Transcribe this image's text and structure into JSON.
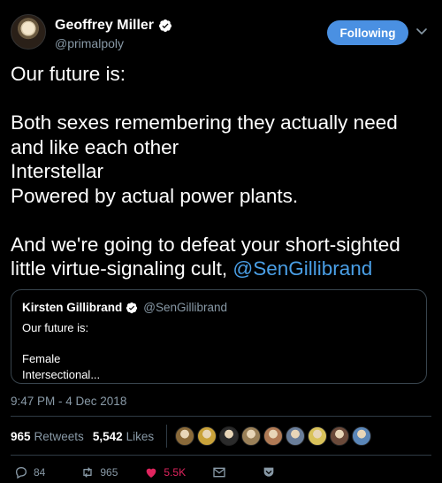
{
  "author": {
    "name": "Geoffrey Miller",
    "handle": "@primalpoly",
    "verified": true
  },
  "follow_button": {
    "label": "Following",
    "color": "#4a90e2"
  },
  "tweet": {
    "text_line1": "Our future is:",
    "text_body": "Both sexes remembering they actually need and like each other\nInterstellar\nPowered by actual power plants.",
    "text_end": "And we're going to defeat your short-sighted little virtue-signaling cult, ",
    "mention": "@SenGillibrand",
    "mention_color": "#4a9fe6"
  },
  "quoted_tweet": {
    "name": "Kirsten Gillibrand",
    "handle": "@SenGillibrand",
    "verified": true,
    "text": "Our future is:\n\nFemale\nIntersectional..."
  },
  "timestamp": "9:47 PM - 4 Dec 2018",
  "stats": {
    "retweets_count": "965",
    "retweets_label": "Retweets",
    "likes_count": "5,542",
    "likes_label": "Likes"
  },
  "liker_avatar_colors": [
    "#8a6a3a",
    "#c9a23a",
    "#2b2b2b",
    "#9a8058",
    "#b07a55",
    "#6a7e9a",
    "#d9c25a",
    "#6b4a3a",
    "#5a86b8"
  ],
  "actions": {
    "reply_count": "84",
    "retweet_count": "965",
    "like_count": "5.5K",
    "like_color": "#e0245e"
  }
}
